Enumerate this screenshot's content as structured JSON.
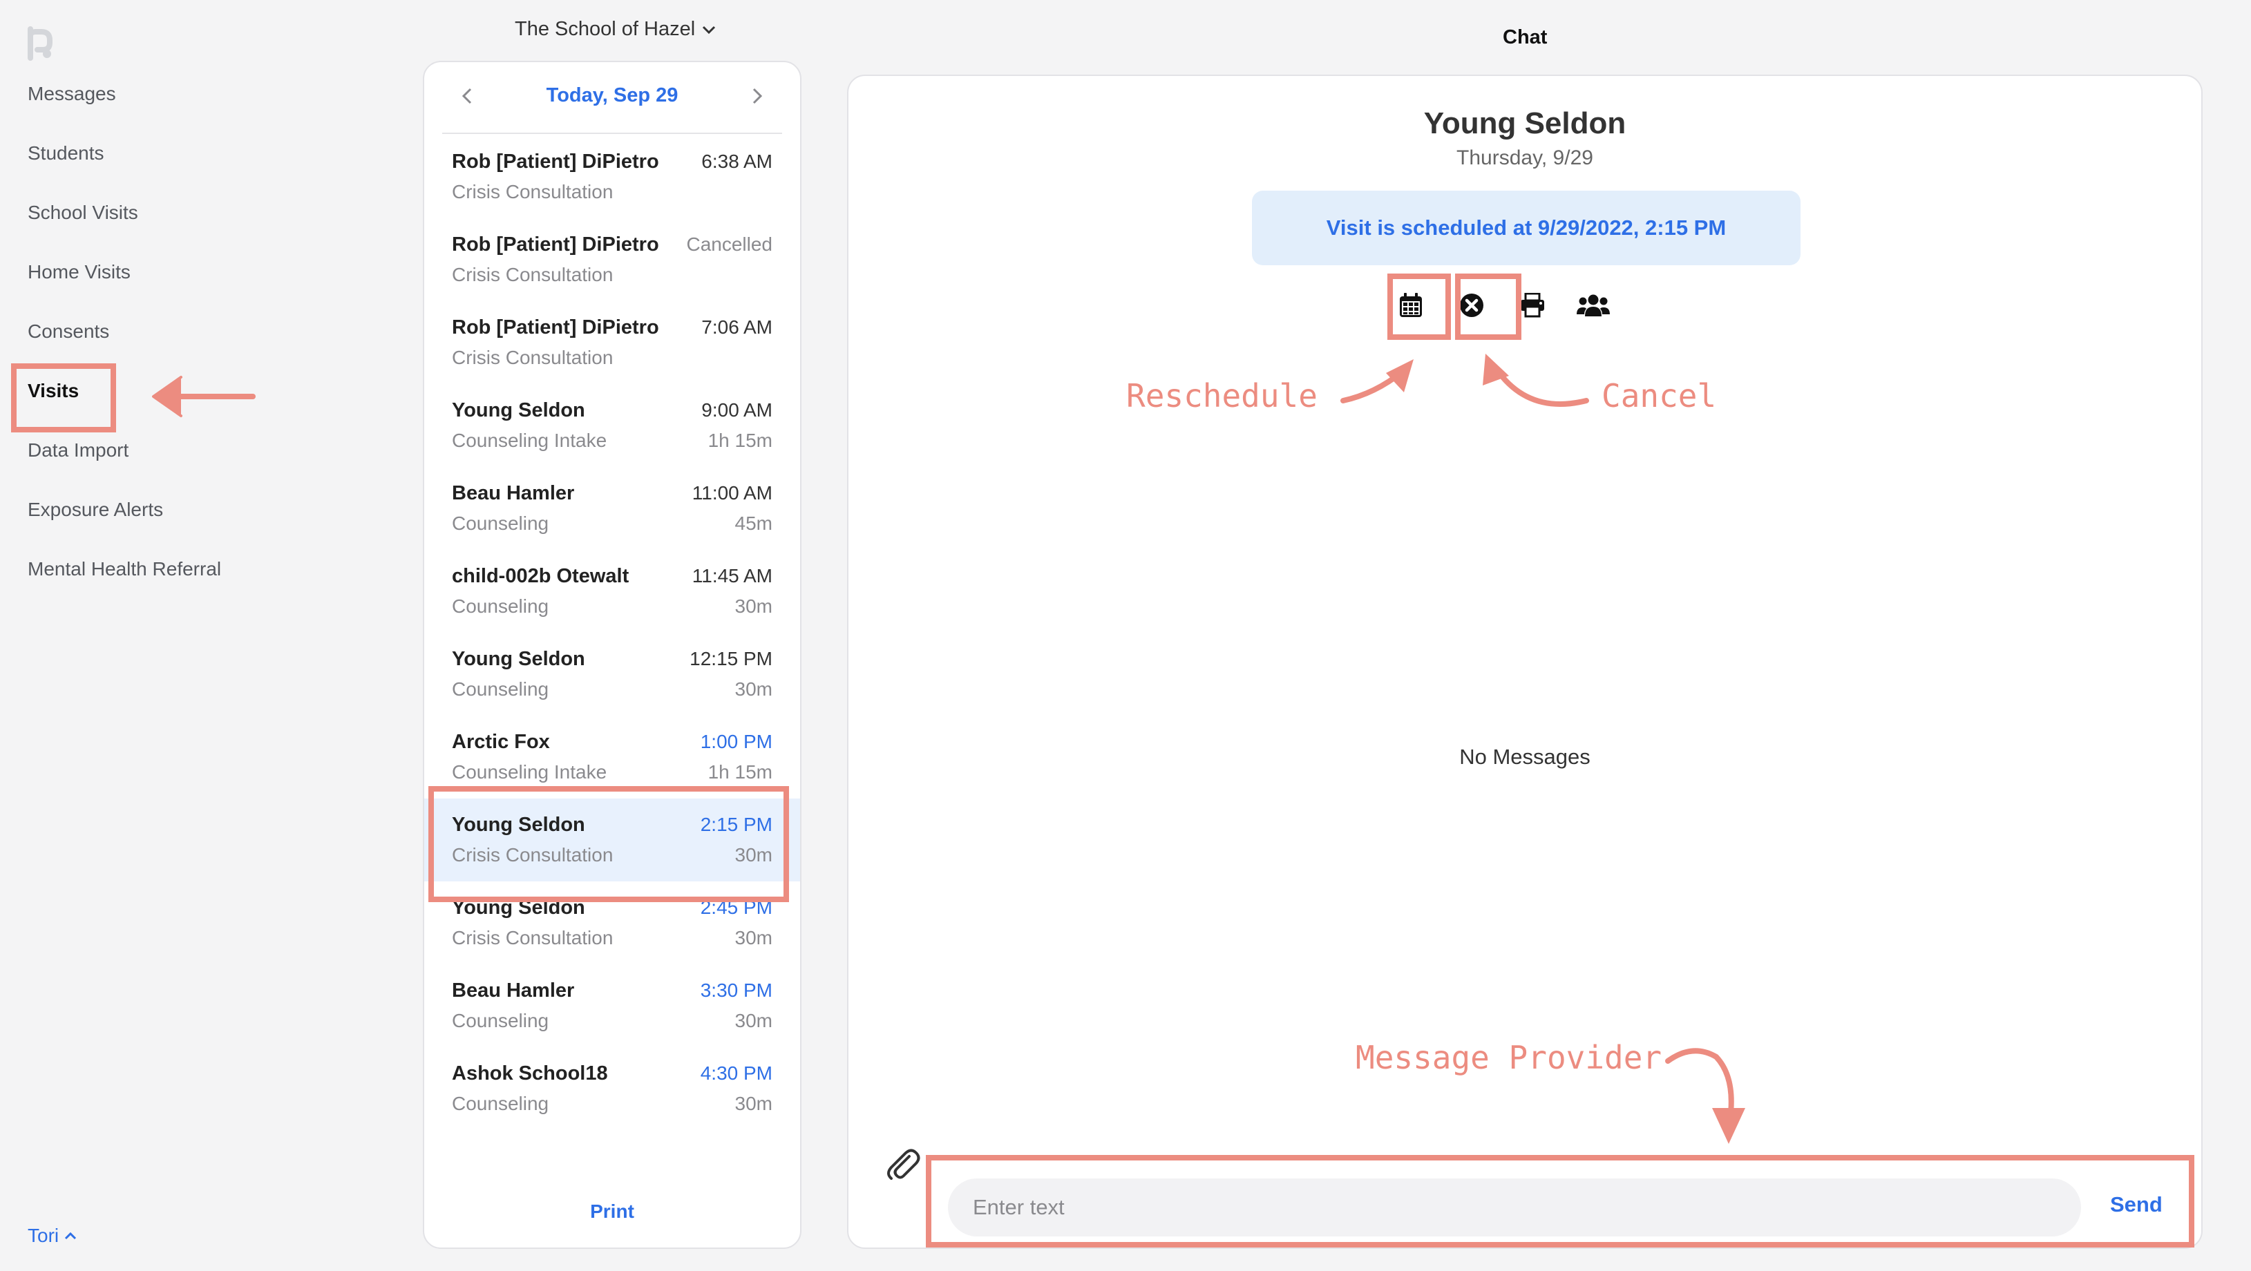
{
  "sidebar": {
    "items": [
      {
        "label": "Messages"
      },
      {
        "label": "Students"
      },
      {
        "label": "School Visits"
      },
      {
        "label": "Home Visits"
      },
      {
        "label": "Consents"
      },
      {
        "label": "Visits",
        "active": true
      },
      {
        "label": "Data Import"
      },
      {
        "label": "Exposure Alerts"
      },
      {
        "label": "Mental Health Referral"
      }
    ],
    "user": "Tori"
  },
  "header": {
    "school": "The School of Hazel",
    "chat_title": "Chat"
  },
  "visits": {
    "date_label": "Today, Sep 29",
    "items": [
      {
        "name": "Rob [Patient] DiPietro",
        "type": "Crisis Consultation",
        "time": "6:38 AM",
        "duration": ""
      },
      {
        "name": "Rob [Patient] DiPietro",
        "type": "Crisis Consultation",
        "time": "Cancelled",
        "duration": ""
      },
      {
        "name": "Rob [Patient] DiPietro",
        "type": "Crisis Consultation",
        "time": "7:06 AM",
        "duration": ""
      },
      {
        "name": "Young Seldon",
        "type": "Counseling Intake",
        "time": "9:00 AM",
        "duration": "1h 15m"
      },
      {
        "name": "Beau Hamler",
        "type": "Counseling",
        "time": "11:00 AM",
        "duration": "45m"
      },
      {
        "name": "child-002b Otewalt",
        "type": "Counseling",
        "time": "11:45 AM",
        "duration": "30m"
      },
      {
        "name": "Young Seldon",
        "type": "Counseling",
        "time": "12:15 PM",
        "duration": "30m"
      },
      {
        "name": "Arctic Fox",
        "type": "Counseling Intake",
        "time": "1:00 PM",
        "duration": "1h 15m"
      },
      {
        "name": "Young Seldon",
        "type": "Crisis Consultation",
        "time": "2:15 PM",
        "duration": "30m"
      },
      {
        "name": "Young Seldon",
        "type": "Crisis Consultation",
        "time": "2:45 PM",
        "duration": "30m"
      },
      {
        "name": "Beau Hamler",
        "type": "Counseling",
        "time": "3:30 PM",
        "duration": "30m"
      },
      {
        "name": "Ashok School18",
        "type": "Counseling",
        "time": "4:30 PM",
        "duration": "30m"
      }
    ],
    "print_label": "Print"
  },
  "chat": {
    "patient_name": "Young Seldon",
    "visit_date": "Thursday, 9/29",
    "scheduled_text": "Visit is scheduled at 9/29/2022, 2:15 PM",
    "actions": [
      {
        "icon": "calendar-icon"
      },
      {
        "icon": "cancel-circle-icon"
      },
      {
        "icon": "print-icon"
      },
      {
        "icon": "users-icon"
      }
    ],
    "empty_text": "No Messages",
    "input_placeholder": "Enter text",
    "send_label": "Send"
  },
  "annotations": {
    "reschedule": "Reschedule",
    "cancel": "Cancel",
    "message_provider": "Message Provider",
    "color": "#ec8c80"
  },
  "colors": {
    "accent": "#2e6fe6",
    "selected_row": "#e8f1fd",
    "banner": "#e2eefb"
  }
}
